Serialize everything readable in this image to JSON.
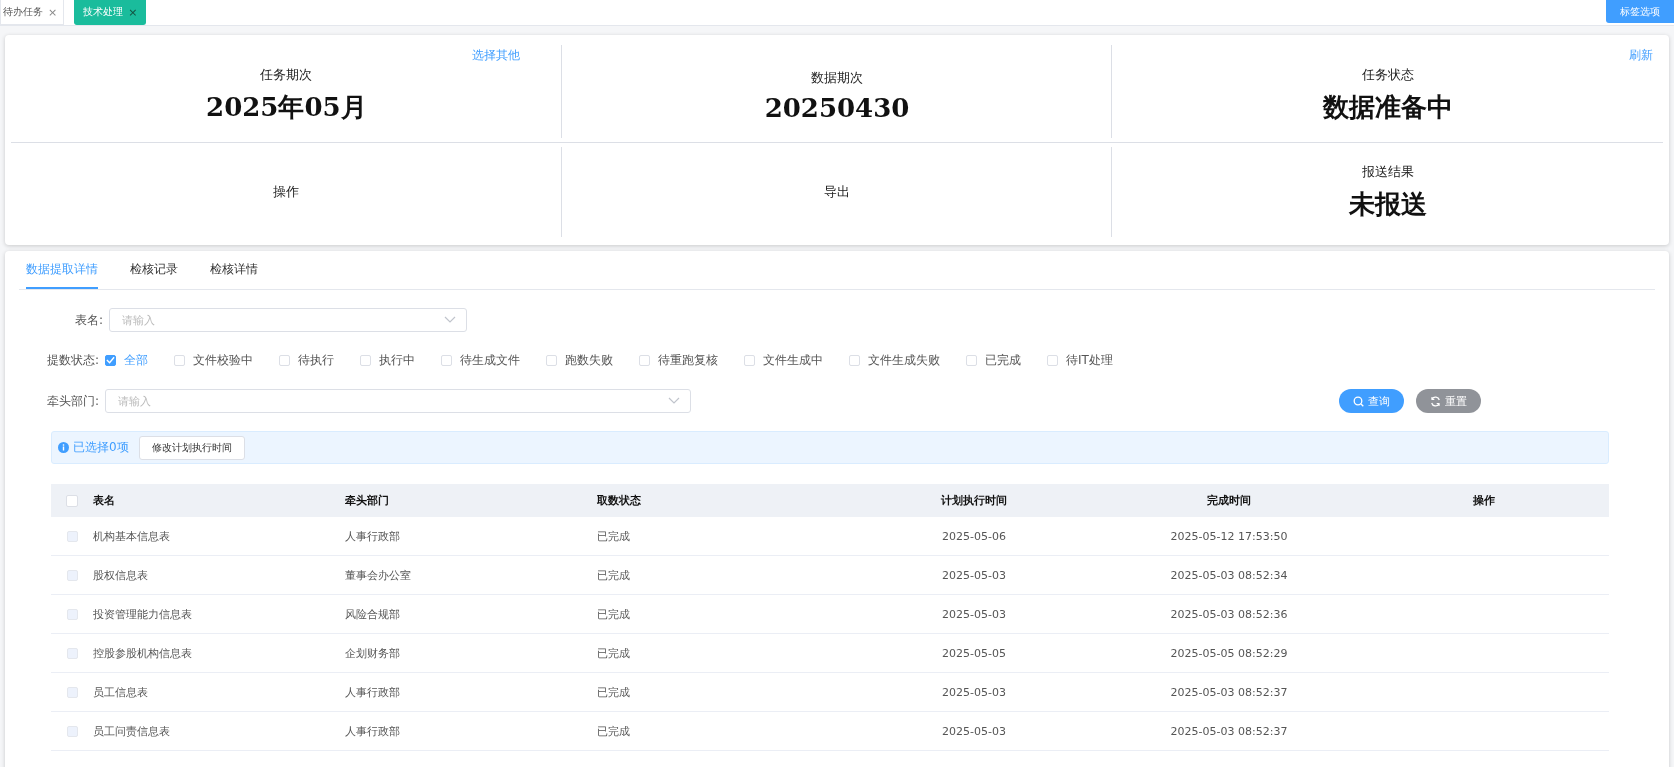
{
  "page_tabs": [
    {
      "label": "待办任务",
      "close": "×",
      "selected": false
    },
    {
      "label": "技术处理",
      "close": "×",
      "selected": true
    }
  ],
  "tab_options_button": "标签选项",
  "summary": {
    "cells": [
      {
        "kind": "serif_value",
        "label": "任务期次",
        "value": "2025年05月",
        "link": "选择其他"
      },
      {
        "kind": "serif_value",
        "label": "数据期次",
        "value": "20250430"
      },
      {
        "kind": "value",
        "label": "任务状态",
        "value": "数据准备中",
        "link": "刷新"
      },
      {
        "kind": "plain",
        "label": "操作"
      },
      {
        "kind": "plain",
        "label": "导出"
      },
      {
        "kind": "value",
        "label": "报送结果",
        "value": "未报送"
      }
    ]
  },
  "detail_tabs": [
    {
      "label": "数据提取详情",
      "selected": true
    },
    {
      "label": "检核记录",
      "selected": false
    },
    {
      "label": "检核详情",
      "selected": false
    }
  ],
  "filters": {
    "table_name": {
      "label": "表名:",
      "placeholder": "请输入"
    },
    "status": {
      "label": "提数状态:",
      "options": [
        {
          "label": "全部",
          "checked": true
        },
        {
          "label": "文件校验中",
          "checked": false
        },
        {
          "label": "待执行",
          "checked": false
        },
        {
          "label": "执行中",
          "checked": false
        },
        {
          "label": "待生成文件",
          "checked": false
        },
        {
          "label": "跑数失败",
          "checked": false
        },
        {
          "label": "待重跑复核",
          "checked": false
        },
        {
          "label": "文件生成中",
          "checked": false
        },
        {
          "label": "文件生成失败",
          "checked": false
        },
        {
          "label": "已完成",
          "checked": false
        },
        {
          "label": "待IT处理",
          "checked": false
        }
      ]
    },
    "department": {
      "label": "牵头部门:",
      "placeholder": "请输入"
    },
    "query_button": "查询",
    "reset_button": "重置"
  },
  "selection_bar": {
    "text": "已选择0项",
    "button": "修改计划执行时间"
  },
  "table": {
    "all_selected": false,
    "columns": [
      "表名",
      "牵头部门",
      "取数状态",
      "计划执行时间",
      "完成时间",
      "操作"
    ],
    "rows": [
      {
        "cells": [
          "机构基本信息表",
          "人事行政部",
          "已完成",
          "2025-05-06",
          "2025-05-12 17:53:50"
        ],
        "selected": false
      },
      {
        "cells": [
          "股权信息表",
          "董事会办公室",
          "已完成",
          "2025-05-03",
          "2025-05-03 08:52:34"
        ],
        "selected": false
      },
      {
        "cells": [
          "投资管理能力信息表",
          "风险合规部",
          "已完成",
          "2025-05-03",
          "2025-05-03 08:52:36"
        ],
        "selected": false
      },
      {
        "cells": [
          "控股参股机构信息表",
          "企划财务部",
          "已完成",
          "2025-05-05",
          "2025-05-05 08:52:29"
        ],
        "selected": false
      },
      {
        "cells": [
          "员工信息表",
          "人事行政部",
          "已完成",
          "2025-05-03",
          "2025-05-03 08:52:37"
        ],
        "selected": false
      },
      {
        "cells": [
          "员工问责信息表",
          "人事行政部",
          "已完成",
          "2025-05-03",
          "2025-05-03 08:52:37"
        ],
        "selected": false
      }
    ]
  }
}
